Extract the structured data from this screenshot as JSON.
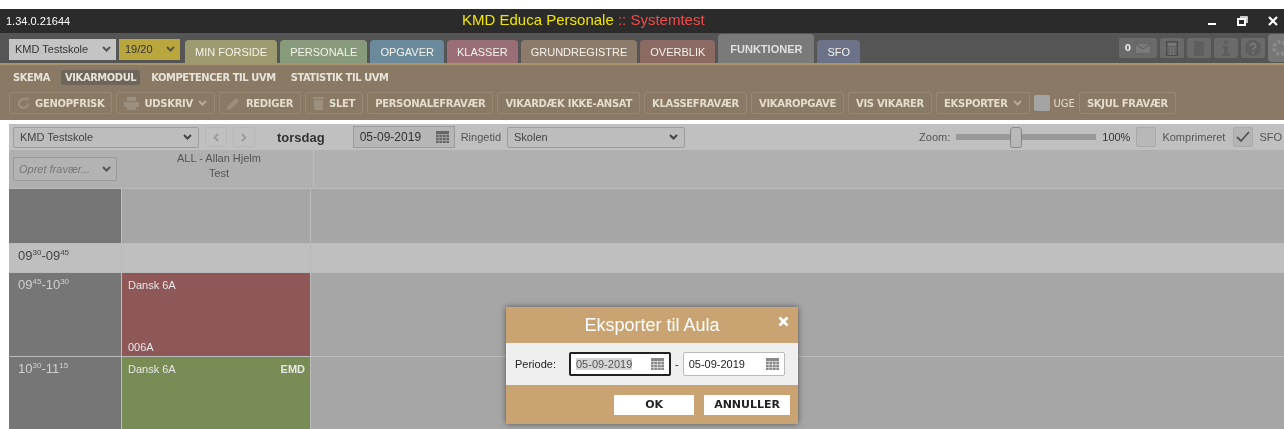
{
  "window": {
    "version": "1.34.0.21644",
    "title": "KMD Educa Personale",
    "subtitle": ":: Systemtest"
  },
  "school_select": {
    "value": "KMD Testskole"
  },
  "year_select": {
    "value": "19/20"
  },
  "tabs": [
    {
      "label": "MIN FORSIDE",
      "color": "#9c9a6e",
      "selected": false
    },
    {
      "label": "PERSONALE",
      "color": "#889a7c",
      "selected": false
    },
    {
      "label": "OPGAVER",
      "color": "#6a8a9c",
      "selected": false
    },
    {
      "label": "KLASSER",
      "color": "#9a6e76",
      "selected": false
    },
    {
      "label": "GRUNDREGISTRE",
      "color": "#8c7a6a",
      "selected": false
    },
    {
      "label": "OVERBLIK",
      "color": "#8a6a62",
      "selected": false
    },
    {
      "label": "FUNKTIONER",
      "color": "#7a7a7a",
      "selected": true
    },
    {
      "label": "SFO",
      "color": "#6c7288",
      "selected": false
    }
  ],
  "message_count": "0",
  "submenu": [
    {
      "label": "SKEMA",
      "selected": false
    },
    {
      "label": "VIKARMODUL",
      "selected": true
    },
    {
      "label": "KOMPETENCER TIL UVM",
      "selected": false
    },
    {
      "label": "STATISTIK TIL UVM",
      "selected": false
    }
  ],
  "toolbar": [
    {
      "kind": "button",
      "label": "GENOPFRISK"
    },
    {
      "kind": "dropdown",
      "label": "UDSKRIV"
    },
    {
      "kind": "button",
      "label": "REDIGER"
    },
    {
      "kind": "button",
      "label": "SLET"
    },
    {
      "kind": "button",
      "label": "PERSONALEFRAVÆR"
    },
    {
      "kind": "button",
      "label": "VIKARDÆK IKKE-ANSAT"
    },
    {
      "kind": "button",
      "label": "KLASSEFRAVÆR"
    },
    {
      "kind": "button",
      "label": "VIKAROPGAVE"
    },
    {
      "kind": "button",
      "label": "VIS VIKARER"
    },
    {
      "kind": "dropdown",
      "label": "EKSPORTER"
    },
    {
      "kind": "checkbox",
      "label": "UGE",
      "checked": false
    },
    {
      "kind": "button",
      "label": "SKJUL FRAVÆR"
    }
  ],
  "filter": {
    "school": "KMD Testskole",
    "day": "torsdag",
    "date": "05-09-2019",
    "ringetid_label": "Ringetid",
    "ringetid": "Skolen",
    "zoom_label": "Zoom:",
    "zoom": {
      "level": 0.43
    },
    "zoom_reading": "100%",
    "options": [
      {
        "label": "Komprimeret",
        "checked": false
      },
      {
        "label": "SFO",
        "checked": true
      }
    ]
  },
  "absence_select": {
    "placeholder": "Opret fravær..."
  },
  "teacher": {
    "name": "ALL  -  Allan Hjelm",
    "subtitle": "Test"
  },
  "rows": [
    {
      "kind": "blank"
    },
    {
      "kind": "break",
      "time": "09$^{30}$-09$^{45}$"
    },
    {
      "kind": "lesson",
      "time": "09$^{45}$-10$^{30}$",
      "subject": "Dansk 6A",
      "room": "006A",
      "color": "#8e5858"
    },
    {
      "kind": "lesson",
      "time": "10$^{30}$-11$^{15}$",
      "subject": "Dansk 6A",
      "badge": "EMD",
      "color": "#7a8c56"
    }
  ],
  "dialog": {
    "title": "Eksporter til Aula",
    "label": "Periode:",
    "from": {
      "value": "05-09-2019",
      "focused": true
    },
    "separator": "-",
    "to": {
      "value": "05-09-2019",
      "focused": false
    },
    "buttons": [
      "OK",
      "ANNULLER"
    ]
  }
}
